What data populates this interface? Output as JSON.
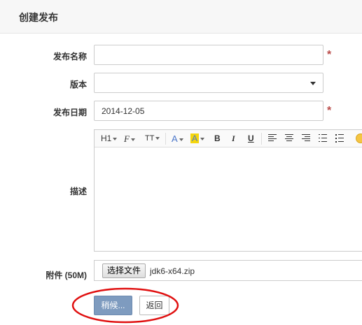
{
  "header": {
    "title": "创建发布"
  },
  "form": {
    "name": {
      "label": "发布名称",
      "value": "",
      "required_mark": "*"
    },
    "version": {
      "label": "版本",
      "value": ""
    },
    "date": {
      "label": "发布日期",
      "value": "2014-12-05",
      "required_mark": "*"
    },
    "description": {
      "label": "描述",
      "toolbar": {
        "heading": "H1",
        "font_family": "F",
        "font_size": "TT",
        "text_color": "A",
        "highlight": "A",
        "bold": "B",
        "italic": "I",
        "underline": "U",
        "highlight_color": "#f5d60c"
      }
    },
    "attachment": {
      "label": "附件 (50M)",
      "choose_button": "选择文件",
      "file_name": "jdk6-x64.zip"
    }
  },
  "actions": {
    "submit_label": "稍候...",
    "back_label": "返回",
    "submit_color": "#7e9bbf"
  },
  "annotation": {
    "color": "#e01010"
  }
}
